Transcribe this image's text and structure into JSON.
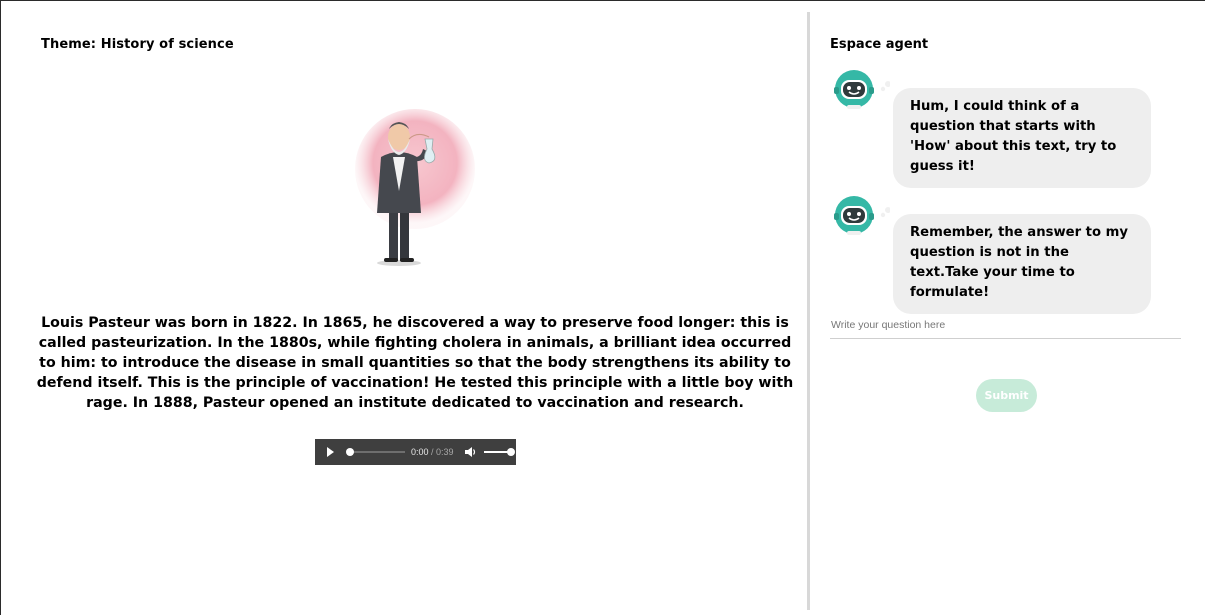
{
  "left": {
    "theme": "Theme: History of science",
    "passage": "Louis Pasteur was born in 1822. In 1865, he discovered a way to preserve food longer: this is called pasteurization. In the 1880s, while fighting cholera in animals, a brilliant idea occurred to him: to introduce the disease in small quantities so that the body strengthens its ability to defend itself. This is the principle of vaccination! He tested this principle with a little boy with rage. In 1888, Pasteur opened an institute dedicated to vaccination and research.",
    "audio": {
      "current": "0:00",
      "duration": "/ 0:39",
      "progress": 0.0,
      "volume": 1.0
    }
  },
  "agent": {
    "title": "Espace agent",
    "messages": [
      {
        "text": "Hum, I could think of a question that starts with 'How' about this text, try to guess it!"
      },
      {
        "text": "Remember, the answer to my question is not in the text.Take your time to formulate!"
      }
    ],
    "input_placeholder": "Write your question here",
    "submit_label": "Submit"
  },
  "colors": {
    "bubble": "#eeeeee",
    "submit": "#c7ebd9",
    "robot_accent": "#35b8a6",
    "audio_bg": "#3f3f3f"
  },
  "icons": {
    "play": "play-icon",
    "volume": "volume-icon",
    "robot": "robot-avatar-icon"
  }
}
